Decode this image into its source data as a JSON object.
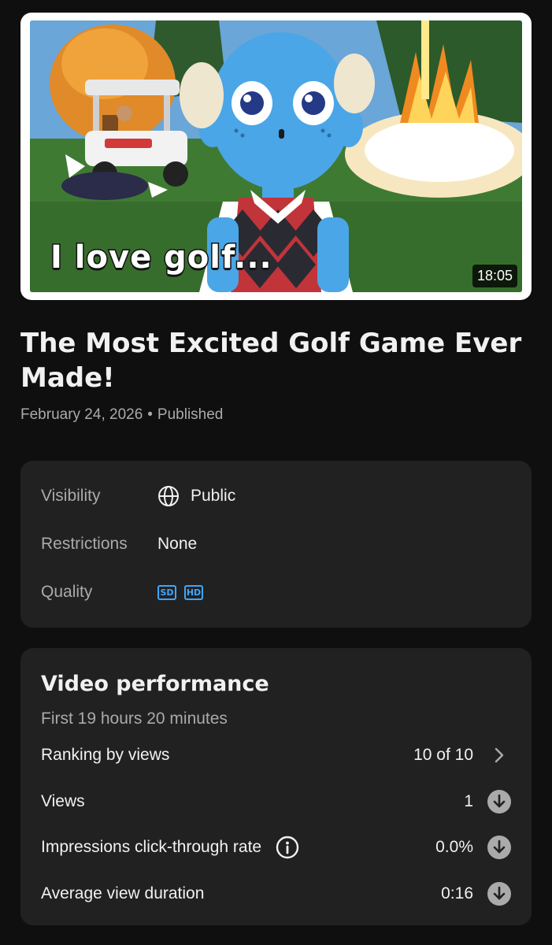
{
  "thumbnail": {
    "overlay_text": "I love golf...",
    "duration": "18:05"
  },
  "video": {
    "title": "The Most Excited Golf Game Ever Made!",
    "date": "February 24, 2026",
    "separator": "•",
    "status": "Published"
  },
  "details": {
    "visibility_label": "Visibility",
    "visibility_value": "Public",
    "visibility_icon": "globe-icon",
    "restrictions_label": "Restrictions",
    "restrictions_value": "None",
    "quality_label": "Quality",
    "quality_badges": [
      "SD",
      "HD"
    ],
    "badge_color": "#3ea6ff"
  },
  "performance": {
    "title": "Video performance",
    "subtitle": "First 19 hours 20 minutes",
    "rows": [
      {
        "label": "Ranking by views",
        "value": "10 of 10",
        "icon": "chevron-right-icon"
      },
      {
        "label": "Views",
        "value": "1",
        "icon": "arrow-down-circle-icon"
      },
      {
        "label": "Impressions click-through rate",
        "value": "0.0%",
        "icon": "arrow-down-circle-icon",
        "info_icon": "info-icon"
      },
      {
        "label": "Average view duration",
        "value": "0:16",
        "icon": "arrow-down-circle-icon"
      }
    ]
  },
  "colors": {
    "background": "#0f0f0f",
    "card": "#212121",
    "text_primary": "#f1f1f1",
    "text_secondary": "#aaaaaa"
  }
}
